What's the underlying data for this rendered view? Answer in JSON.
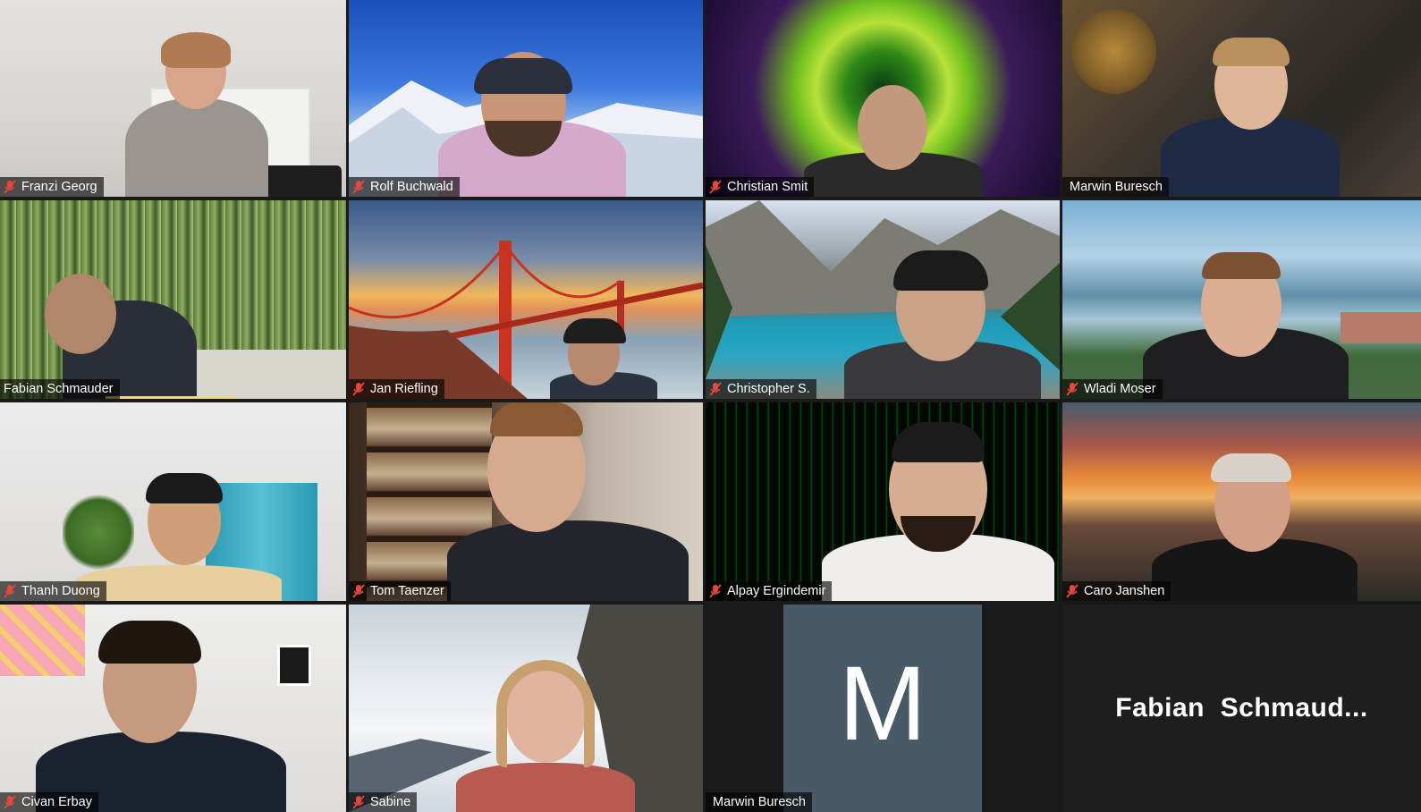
{
  "participants": [
    {
      "name": "Franzi Georg",
      "muted": true
    },
    {
      "name": "Rolf Buchwald",
      "muted": true
    },
    {
      "name": "Christian Smit",
      "muted": true
    },
    {
      "name": "Marwin Buresch",
      "muted": false,
      "active_speaker": true
    },
    {
      "name": "Fabian Schmauder",
      "muted": false
    },
    {
      "name": "Jan Riefling",
      "muted": true
    },
    {
      "name": "Christopher S.",
      "muted": true
    },
    {
      "name": "Wladi Moser",
      "muted": true
    },
    {
      "name": "Thanh Duong",
      "muted": true
    },
    {
      "name": "Tom Taenzer",
      "muted": true
    },
    {
      "name": "Alpay Ergindemir",
      "muted": true
    },
    {
      "name": "Caro Janshen",
      "muted": true
    },
    {
      "name": "Civan Erbay",
      "muted": true
    },
    {
      "name": "Sabine",
      "muted": true
    },
    {
      "name": "Marwin Buresch",
      "muted": false,
      "video_off": true,
      "avatar_letter": "M"
    },
    {
      "name": "Fabian  Schmaud...",
      "video_off": true,
      "name_only": true
    }
  ],
  "colors": {
    "muted_icon": "#e8453c",
    "speaker_highlight": "#f0de6a",
    "avatar_bg": "#475a66",
    "grid_bg": "#1a1a1a"
  },
  "icons": {
    "muted": "microphone-muted-icon"
  }
}
